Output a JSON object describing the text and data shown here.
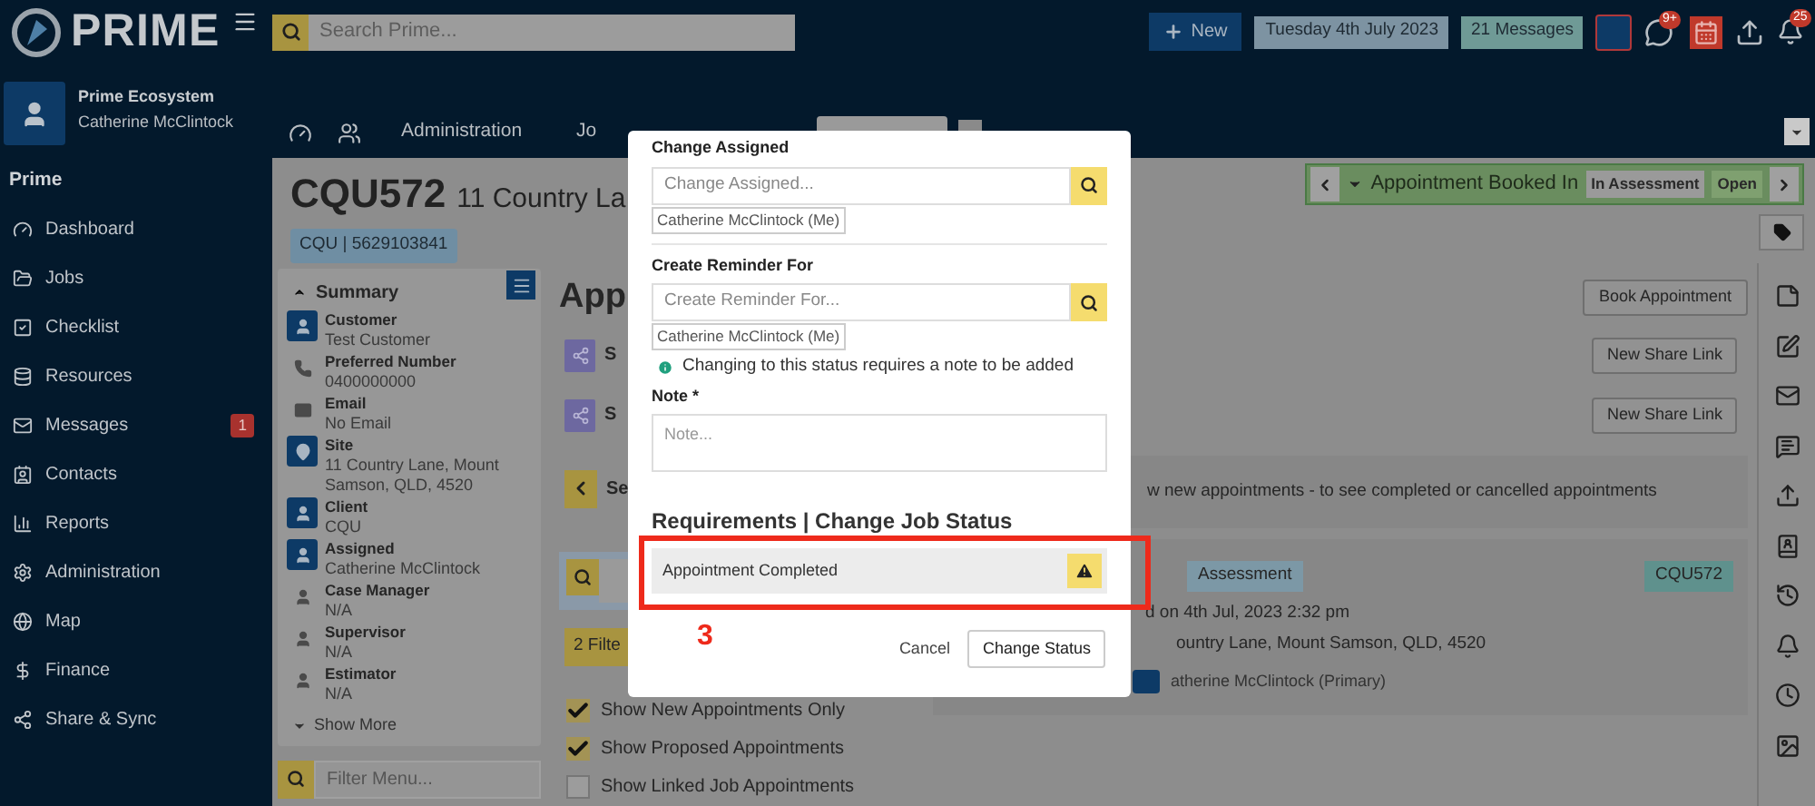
{
  "header": {
    "logo": "PRIME",
    "search": {
      "placeholder": "Search Prime..."
    },
    "new_button": "New",
    "date": "Tuesday 4th July 2023",
    "messages": "21 Messages",
    "chat_badge": "9+",
    "bell_badge": "25"
  },
  "user": {
    "org": "Prime Ecosystem",
    "name": "Catherine McClintock"
  },
  "sidebar": {
    "title": "Prime",
    "items": [
      {
        "label": "Dashboard"
      },
      {
        "label": "Jobs"
      },
      {
        "label": "Checklist"
      },
      {
        "label": "Resources"
      },
      {
        "label": "Messages",
        "badge": "1"
      },
      {
        "label": "Contacts"
      },
      {
        "label": "Reports"
      },
      {
        "label": "Administration"
      },
      {
        "label": "Map"
      },
      {
        "label": "Finance"
      },
      {
        "label": "Share & Sync"
      }
    ]
  },
  "tabs": [
    {
      "label": "Administration",
      "selected": false
    },
    {
      "label": "Jo",
      "selected": false
    }
  ],
  "job": {
    "code": "CQU572",
    "address": "11 Country La",
    "chip": "CQU | 5629103841"
  },
  "status_bar": {
    "status": "Appointment Booked In",
    "tags": [
      "In Assessment",
      "Open"
    ]
  },
  "summary": {
    "title": "Summary",
    "expanded": true,
    "items": [
      {
        "label": "Customer",
        "value": "Test Customer",
        "boxed": true
      },
      {
        "label": "Preferred Number",
        "value": "0400000000",
        "boxed": false
      },
      {
        "label": "Email",
        "value": "No Email",
        "boxed": false
      },
      {
        "label": "Site",
        "value": "11 Country Lane, Mount Samson, QLD, 4520",
        "boxed": true
      },
      {
        "label": "Client",
        "value": "CQU",
        "boxed": true
      },
      {
        "label": "Assigned",
        "value": "Catherine McClintock",
        "boxed": true
      },
      {
        "label": "Case Manager",
        "value": "N/A",
        "boxed": false
      },
      {
        "label": "Supervisor",
        "value": "N/A",
        "boxed": false
      },
      {
        "label": "Estimator",
        "value": "N/A",
        "boxed": false
      }
    ],
    "show_more": "Show More",
    "filter": {
      "placeholder": "Filter Menu..."
    }
  },
  "appointments": {
    "heading": "App",
    "book_button": "Book Appointment",
    "share_rows": [
      {
        "label": "S",
        "button": "New Share Link"
      },
      {
        "label": "S",
        "button": "New Share Link"
      }
    ],
    "back_label": "Se",
    "filter_button": "2 Filte",
    "filters": [
      {
        "label": "Show New Appointments Only",
        "checked": true
      },
      {
        "label": "Show Proposed Appointments",
        "checked": true
      },
      {
        "label": "Show Linked Job Appointments",
        "checked": false
      }
    ],
    "info": "w new appointments - to see completed or cancelled appointments",
    "card": {
      "badge": "Assessment",
      "code": "CQU572",
      "lines": [
        "d on 4th Jul, 2023 2:32 pm",
        "ountry Lane, Mount Samson, QLD, 4520"
      ],
      "assignee": "atherine McClintock (Primary)"
    }
  },
  "modal": {
    "assigned": {
      "label": "Change Assigned",
      "placeholder": "Change Assigned...",
      "chip": "Catherine McClintock (Me)"
    },
    "reminder": {
      "label": "Create Reminder For",
      "placeholder": "Create Reminder For...",
      "chip": "Catherine McClintock (Me)"
    },
    "info": "Changing to this status requires a note to be added",
    "note": {
      "label": "Note *",
      "placeholder": "Note..."
    },
    "requirements_title": "Requirements | Change Job Status",
    "requirements": [
      {
        "label": "Appointment Completed"
      }
    ],
    "buttons": {
      "cancel": "Cancel",
      "confirm": "Change Status"
    }
  },
  "annotation": {
    "label": "3"
  }
}
